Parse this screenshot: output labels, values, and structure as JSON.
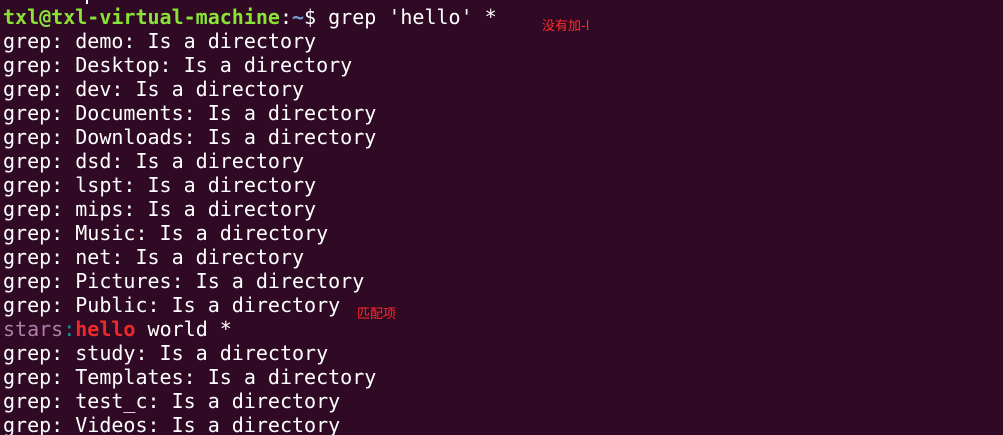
{
  "terminal": {
    "prompt": {
      "user_host": "txl@txl-virtual-machine",
      "colon": ":",
      "path": "~",
      "symbol": "$ ",
      "command": "grep 'hello' *"
    },
    "output": [
      "grep: demo: Is a directory",
      "grep: Desktop: Is a directory",
      "grep: dev: Is a directory",
      "grep: Documents: Is a directory",
      "grep: Downloads: Is a directory",
      "grep: dsd: Is a directory",
      "grep: lspt: Is a directory",
      "grep: mips: Is a directory",
      "grep: Music: Is a directory",
      "grep: net: Is a directory",
      "grep: Pictures: Is a directory",
      "grep: Public: Is a directory"
    ],
    "match_line": {
      "filename": "stars",
      "separator": ":",
      "match": "hello",
      "rest": " world *"
    },
    "output_after": [
      "grep: study: Is a directory",
      "grep: Templates: Is a directory",
      "grep: test_c: Is a directory",
      "grep: Videos: Is a directory"
    ]
  },
  "annotations": {
    "note_top": "没有加-l",
    "note_match": "匹配项"
  },
  "colors": {
    "background": "#300a24",
    "prompt_user": "#8ae234",
    "prompt_path": "#729fcf",
    "match": "#ef2929",
    "filename": "#ad7fa8",
    "annotation": "#ff2a2a"
  }
}
